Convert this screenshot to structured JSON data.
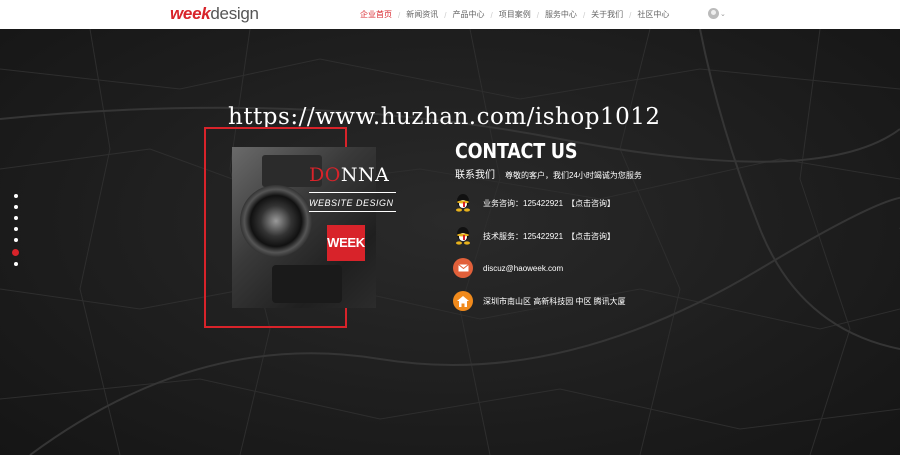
{
  "header": {
    "logo_part1": "week",
    "logo_part2": "design",
    "nav": [
      {
        "label": "企业首页",
        "active": true
      },
      {
        "label": "新闻资讯",
        "active": false
      },
      {
        "label": "产品中心",
        "active": false
      },
      {
        "label": "项目案例",
        "active": false
      },
      {
        "label": "服务中心",
        "active": false
      },
      {
        "label": "关于我们",
        "active": false
      },
      {
        "label": "社区中心",
        "active": false
      }
    ],
    "user_icon": "user-avatar-icon",
    "dropdown_icon": "chevron-down-icon"
  },
  "watermark": "https://www.huzhan.com/ishop1012",
  "side_nav": {
    "count": 6,
    "active_index": 5
  },
  "card": {
    "brand_prefix": "DO",
    "brand_suffix": "NNA",
    "tagline": "WEBSITE DESIGN",
    "badge": "WEEK"
  },
  "contact": {
    "title": "CONTACT US",
    "subtitle": "联系我们",
    "greeting": "尊敬的客户，我们24小时竭诚为您服务",
    "items": [
      {
        "icon": "qq-icon",
        "text": "业务咨询：125422921",
        "link": "【点击咨询】"
      },
      {
        "icon": "qq-icon",
        "text": "技术服务：125422921",
        "link": "【点击咨询】"
      },
      {
        "icon": "mail-icon",
        "text": "discuz@haoweek.com",
        "link": ""
      },
      {
        "icon": "home-icon",
        "text": "深圳市南山区 高新科技园 中区   腾讯大厦",
        "link": ""
      }
    ]
  },
  "colors": {
    "accent": "#d8232a",
    "background": "#1b1b1b",
    "header_bg": "#ffffff"
  }
}
